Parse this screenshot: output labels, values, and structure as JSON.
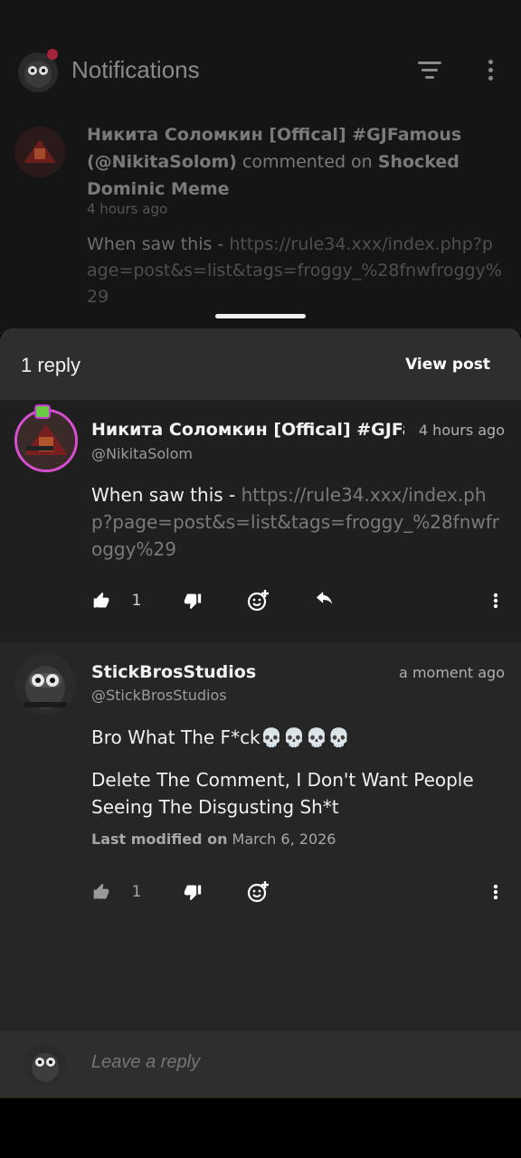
{
  "background": {
    "title": "Notifications",
    "notification": {
      "actor": "Никита Соломкин [Offical] #GJFamous (@NikitaSolom)",
      "verb": "commented on",
      "target": "Shocked Dominic Meme",
      "time": "4 hours ago",
      "body_prefix": "When saw this - ",
      "body_link": "https://rule34.xxx/index.php?page=post&s=list&tags=froggy_%28fnwfroggy%29"
    }
  },
  "sheet": {
    "reply_count": "1 reply",
    "view_post_label": "View post",
    "comments": [
      {
        "name": "Никита Соломкин [Offical] #GJFamous",
        "handle": "@NikitaSolom",
        "time": "4 hours ago",
        "body_prefix": "When saw this - ",
        "body_link": "https://rule34.xxx/index.php?page=post&s=list&tags=froggy_%28fnwfroggy%29",
        "likes": "1"
      },
      {
        "name": "StickBrosStudios",
        "handle": "@StickBrosStudios",
        "time": "a moment ago",
        "body_line1": "Bro What The F*ck💀💀💀💀",
        "body_line2": "Delete The Comment, I Don't Want People Seeing The Disgusting Sh*t",
        "modified_label": "Last modified on",
        "modified_date": "March 6, 2026",
        "likes": "1"
      }
    ]
  },
  "reply_bar": {
    "placeholder": "Leave a reply"
  },
  "icons": {
    "like": "thumbs-up-icon",
    "dislike": "thumbs-down-icon",
    "emoji": "add-emoji-icon",
    "reply": "reply-icon",
    "more": "more-vertical-icon",
    "filter": "filter-icon"
  },
  "colors": {
    "sheet_bg": "#242424",
    "header_bg": "#2e2e2e",
    "link": "#7a7a7a",
    "avatar_ring": "#d64fd0"
  }
}
